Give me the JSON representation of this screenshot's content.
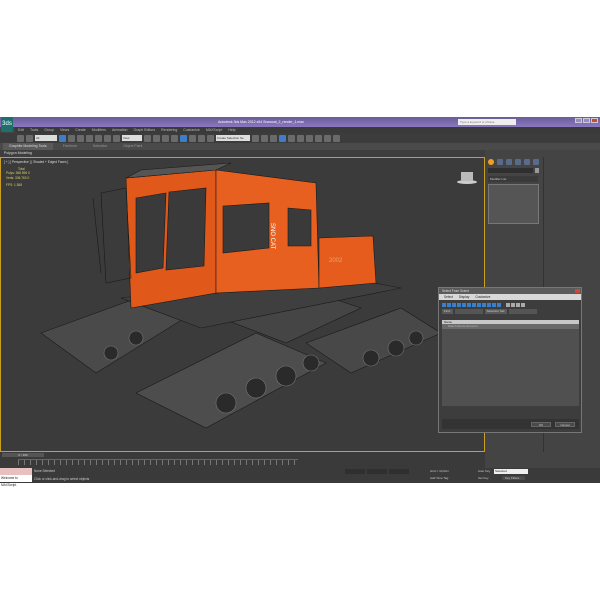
{
  "app": {
    "title": "Autodesk 3ds Max 2012 x64     Snowcat_2_render_1.max",
    "search_placeholder": "Type a keyword or phrase",
    "logo": "3ds"
  },
  "menu": [
    "Edit",
    "Tools",
    "Group",
    "Views",
    "Create",
    "Modifiers",
    "Animation",
    "Graph Editors",
    "Rendering",
    "Customize",
    "MAXScript",
    "Help"
  ],
  "toolbar": {
    "filter": "All",
    "ref_coord": "View",
    "named_sel": "Create Selection Se"
  },
  "ribbon": {
    "tabs": [
      "Graphite Modeling Tools",
      "Freeform",
      "Selection",
      "Object Paint"
    ],
    "panel": "Polygon Modeling"
  },
  "viewport": {
    "label": "[ + ] [ Perspective ] [ Shaded + Edged Faces ]",
    "stats": {
      "header": "Total",
      "polys_label": "Polys:",
      "polys": "368 596",
      "polys_sel": "0",
      "verts_label": "Verts:",
      "verts": "336 763",
      "verts_sel": "0",
      "fps_label": "FPS:",
      "fps": "1.368"
    },
    "decal_text": "SNO CAT",
    "number": "2002"
  },
  "command_panel": {
    "modifier_list": "Modifier List"
  },
  "dialog": {
    "title": "Select From Scene",
    "menu": [
      "Select",
      "Display",
      "Customize"
    ],
    "find_label": "Find:",
    "selection_set_label": "Selection Set:",
    "column_name": "Name",
    "rows": [
      "Hitech-Snow-Groomer"
    ],
    "ok": "OK",
    "cancel": "Cancel"
  },
  "timeline": {
    "frame": "0 / 100"
  },
  "status": {
    "maxscript": "",
    "welcome": "Welcome to MAXScript.",
    "selection": "None Selected",
    "prompt": "Click or click-and-drag to select objects",
    "grid": "Grid = 10,0cm",
    "add_time_tag": "Add Time Tag",
    "auto_key": "Auto Key",
    "selected": "Selected",
    "set_key": "Set Key",
    "key_filters": "Key Filters..."
  }
}
